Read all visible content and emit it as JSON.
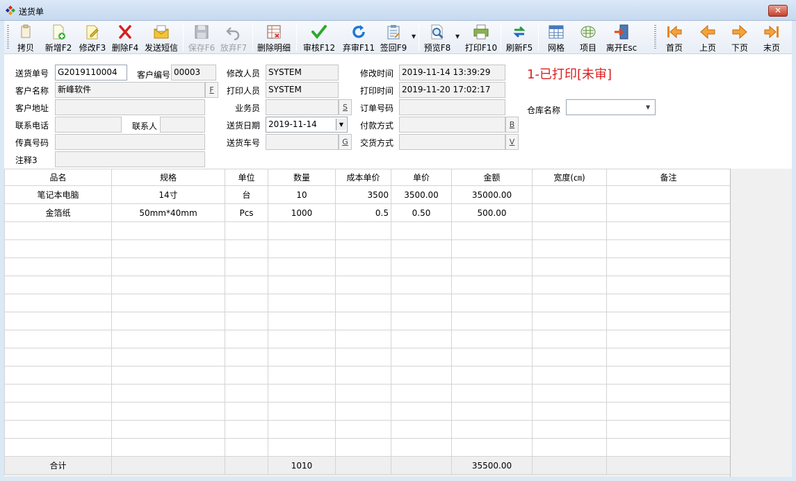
{
  "window": {
    "title": "送货单",
    "close_label": "✕"
  },
  "colors": {
    "status": "#dc1e1e"
  },
  "toolbar": {
    "buttons": [
      {
        "id": "copy",
        "label": "拷贝",
        "icon": "copy-icon",
        "enabled": true
      },
      {
        "id": "new",
        "label": "新增F2",
        "icon": "new-doc-icon",
        "enabled": true
      },
      {
        "id": "edit",
        "label": "修改F3",
        "icon": "edit-icon",
        "enabled": true
      },
      {
        "id": "delete",
        "label": "删除F4",
        "icon": "delete-icon",
        "enabled": true
      },
      {
        "id": "sms",
        "label": "发送短信",
        "icon": "sms-icon",
        "enabled": true
      },
      {
        "id": "save",
        "label": "保存F6",
        "icon": "save-icon",
        "enabled": false
      },
      {
        "id": "discard",
        "label": "放弃F7",
        "icon": "undo-icon",
        "enabled": false
      },
      {
        "id": "delete_detail",
        "label": "删除明细",
        "icon": "delete-detail-icon",
        "enabled": true
      },
      {
        "id": "approve",
        "label": "审核F12",
        "icon": "check-icon",
        "enabled": true
      },
      {
        "id": "unapprove",
        "label": "弃审F11",
        "icon": "refresh-blue-icon",
        "enabled": true
      },
      {
        "id": "sign",
        "label": "签回F9",
        "icon": "clipboard-icon",
        "enabled": true
      },
      {
        "id": "preview",
        "label": "预览F8",
        "icon": "preview-icon",
        "enabled": true
      },
      {
        "id": "print",
        "label": "打印F10",
        "icon": "printer-icon",
        "enabled": true
      },
      {
        "id": "refresh",
        "label": "刷新F5",
        "icon": "sync-icon",
        "enabled": true
      },
      {
        "id": "grid",
        "label": "网格",
        "icon": "grid-icon",
        "enabled": true
      },
      {
        "id": "items",
        "label": "项目",
        "icon": "items-icon",
        "enabled": true
      },
      {
        "id": "exit",
        "label": "离开Esc",
        "icon": "exit-icon",
        "enabled": true
      },
      {
        "id": "first",
        "label": "首页",
        "icon": "first-page-icon",
        "enabled": true
      },
      {
        "id": "prev",
        "label": "上页",
        "icon": "prev-page-icon",
        "enabled": true
      },
      {
        "id": "next",
        "label": "下页",
        "icon": "next-page-icon",
        "enabled": true
      },
      {
        "id": "last",
        "label": "末页",
        "icon": "last-page-icon",
        "enabled": true
      }
    ]
  },
  "form": {
    "order_no": {
      "label": "送货单号",
      "value": "G2019110004"
    },
    "customer_code": {
      "label": "客户编号",
      "value": "00003"
    },
    "customer_name": {
      "label": "客户名称",
      "value": "新峰软件",
      "button": "F"
    },
    "customer_address": {
      "label": "客户地址",
      "value": ""
    },
    "phone": {
      "label": "联系电话",
      "value": ""
    },
    "contact": {
      "label": "联系人",
      "value": ""
    },
    "fax": {
      "label": "传真号码",
      "value": ""
    },
    "note3": {
      "label": "注释3",
      "value": ""
    },
    "modifier": {
      "label": "修改人员",
      "value": "SYSTEM"
    },
    "printer": {
      "label": "打印人员",
      "value": "SYSTEM"
    },
    "salesman": {
      "label": "业务员",
      "value": "",
      "button": "S"
    },
    "delivery_date": {
      "label": "送货日期",
      "value": "2019-11-14"
    },
    "vehicle": {
      "label": "送货车号",
      "value": "",
      "button": "G"
    },
    "modify_time": {
      "label": "修改时间",
      "value": "2019-11-14 13:39:29"
    },
    "print_time": {
      "label": "打印时间",
      "value": "2019-11-20 17:02:17"
    },
    "order_code": {
      "label": "订单号码",
      "value": ""
    },
    "payment": {
      "label": "付款方式",
      "value": "",
      "button": "B"
    },
    "delivery_method": {
      "label": "交货方式",
      "value": "",
      "button": "V"
    },
    "warehouse": {
      "label": "仓库名称",
      "value": ""
    },
    "status": "1-已打印[未审]"
  },
  "grid": {
    "columns": [
      "品名",
      "规格",
      "单位",
      "数量",
      "成本单价",
      "单价",
      "金额",
      "宽度(㎝)",
      "备注"
    ],
    "rows": [
      [
        "笔记本电脑",
        "14寸",
        "台",
        "10",
        "3500",
        "3500.00",
        "35000.00",
        "",
        ""
      ],
      [
        "金箔纸",
        "50mm*40mm",
        "Pcs",
        "1000",
        "0.5",
        "0.50",
        "500.00",
        "",
        ""
      ]
    ],
    "empty_rows": 13,
    "footer": [
      "合计",
      "",
      "",
      "1010",
      "",
      "",
      "35500.00",
      "",
      ""
    ]
  }
}
